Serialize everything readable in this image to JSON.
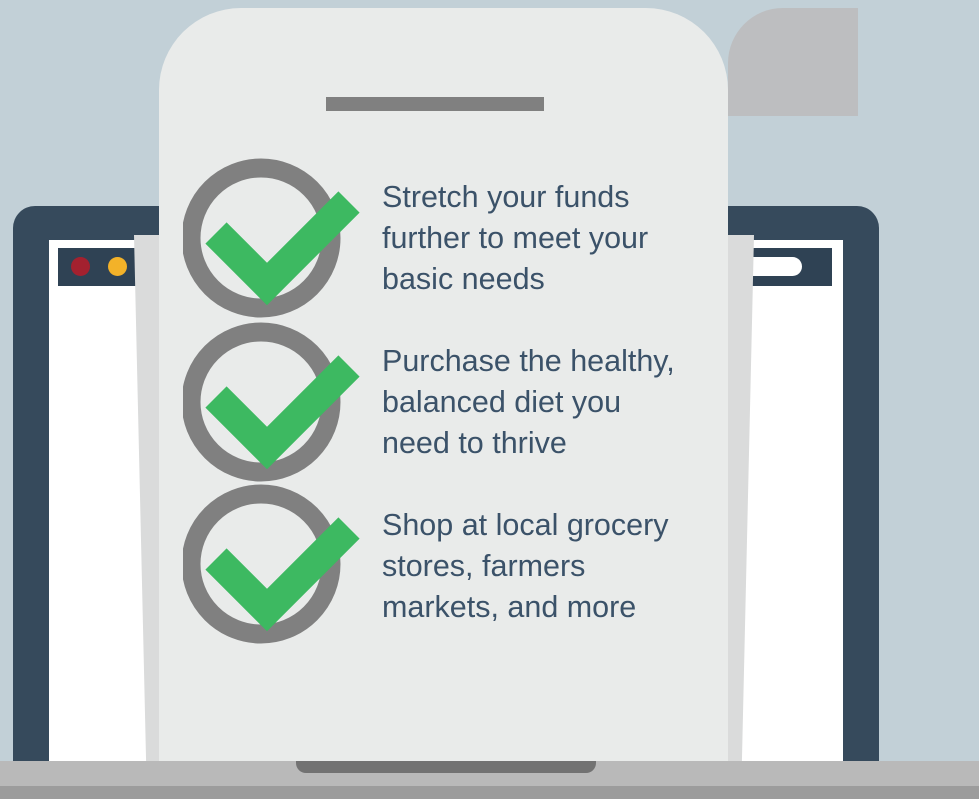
{
  "checklist": {
    "items": [
      {
        "text": "Stretch your funds\nfurther to meet your\nbasic needs"
      },
      {
        "text": "Purchase the healthy,\nbalanced diet you\nneed to thrive"
      },
      {
        "text": "Shop at local grocery\nstores, farmers\nmarkets, and more"
      }
    ]
  },
  "icons": {
    "check": "checkmark-circle-icon",
    "browser_dots": [
      "close-dot-icon",
      "minimize-dot-icon",
      "maximize-dot-icon"
    ]
  },
  "colors": {
    "background": "#c2d0d7",
    "laptop": "#364a5c",
    "paper": "#e9ebea",
    "ring": "#808080",
    "check": "#3db961",
    "text": "#3b5269",
    "dot_red": "#a3212f",
    "dot_yellow": "#f3b229",
    "dot_blue": "#4db6d6"
  }
}
